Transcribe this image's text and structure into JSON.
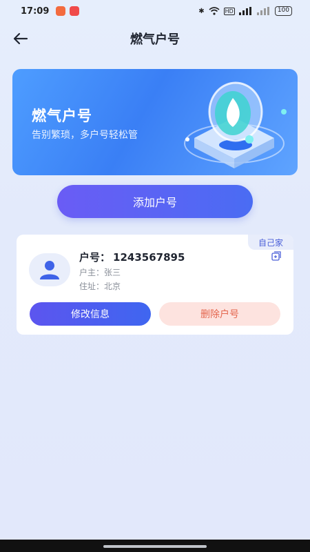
{
  "status_bar": {
    "time": "17:09",
    "battery": "100",
    "icons": [
      "bluetooth-icon",
      "wifi-icon",
      "hd-icon",
      "5g-signal-icon",
      "signal-icon",
      "battery-icon"
    ]
  },
  "header": {
    "title": "燃气户号",
    "back_icon": "arrow-left-icon"
  },
  "banner": {
    "title": "燃气户号",
    "subtitle": "告别繁琐，多户号轻松管"
  },
  "add_button": {
    "label": "添加户号"
  },
  "account": {
    "tag": "自己家",
    "number_label": "户号：",
    "number": "1243567895",
    "owner": "户主：张三",
    "address": "住址：北京",
    "edit_label": "修改信息",
    "delete_label": "删除户号"
  },
  "colors": {
    "accent": "#4a6cf3",
    "delete_text": "#e4664e",
    "delete_bg": "#fde3df"
  }
}
